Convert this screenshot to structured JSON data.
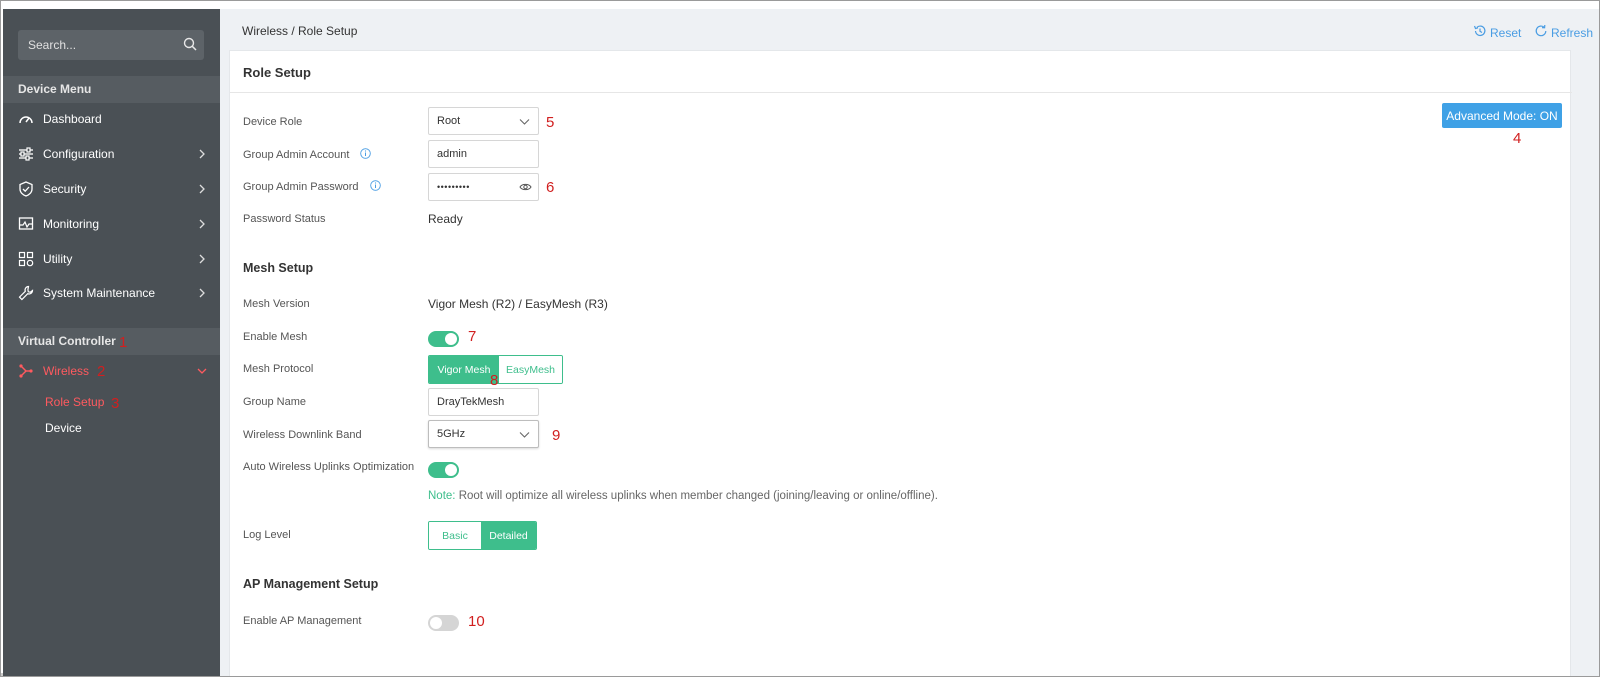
{
  "search": {
    "placeholder": "Search..."
  },
  "sidebar": {
    "device_menu_header": "Device Menu",
    "items": [
      {
        "label": "Dashboard",
        "icon": "dashboard-icon"
      },
      {
        "label": "Configuration",
        "icon": "sliders-icon"
      },
      {
        "label": "Security",
        "icon": "shield-icon"
      },
      {
        "label": "Monitoring",
        "icon": "monitor-icon"
      },
      {
        "label": "Utility",
        "icon": "grid-icon"
      },
      {
        "label": "System Maintenance",
        "icon": "wrench-icon"
      }
    ],
    "virtual_controller_header": "Virtual Controller",
    "wireless": {
      "label": "Wireless",
      "icon": "mesh-icon"
    },
    "sub_items": [
      {
        "label": "Role Setup"
      },
      {
        "label": "Device"
      }
    ]
  },
  "markers": {
    "m1": "1",
    "m2": "2",
    "m3": "3",
    "m4": "4",
    "m5": "5",
    "m6": "6",
    "m7": "7",
    "m8": "8",
    "m9": "9",
    "m10": "10"
  },
  "header": {
    "breadcrumb": "Wireless / Role Setup",
    "reset": "Reset",
    "refresh": "Refresh"
  },
  "card": {
    "title": "Role Setup",
    "advanced_mode": "Advanced Mode: ON",
    "device_role": {
      "label": "Device Role",
      "value": "Root"
    },
    "group_admin_account": {
      "label": "Group Admin Account",
      "value": "admin"
    },
    "group_admin_password": {
      "label": "Group Admin Password",
      "value": "•••••••••"
    },
    "password_status": {
      "label": "Password Status",
      "value": "Ready"
    },
    "mesh_setup_title": "Mesh Setup",
    "mesh_version": {
      "label": "Mesh Version",
      "value": "Vigor Mesh (R2) / EasyMesh (R3)"
    },
    "enable_mesh": {
      "label": "Enable Mesh",
      "on": true
    },
    "mesh_protocol": {
      "label": "Mesh Protocol",
      "options": [
        "Vigor Mesh",
        "EasyMesh"
      ],
      "selected": "Vigor Mesh"
    },
    "group_name": {
      "label": "Group Name",
      "value": "DrayTekMesh"
    },
    "wireless_downlink_band": {
      "label": "Wireless Downlink Band",
      "value": "5GHz"
    },
    "auto_uplinks": {
      "label": "Auto Wireless Uplinks Optimization",
      "on": true
    },
    "note_key": "Note:",
    "note_text": " Root will optimize all wireless uplinks when member changed (joining/leaving or online/offline).",
    "log_level": {
      "label": "Log Level",
      "options": [
        "Basic",
        "Detailed"
      ],
      "selected": "Detailed"
    },
    "ap_mgmt_title": "AP Management Setup",
    "enable_ap_mgmt": {
      "label": "Enable AP Management",
      "on": false
    }
  },
  "colors": {
    "accent_green": "#3ebe8c",
    "accent_blue": "#3fa1e6",
    "sidebar_bg": "#4a5055",
    "active_red": "#ff5a5f",
    "marker_red": "#d11f1f"
  }
}
